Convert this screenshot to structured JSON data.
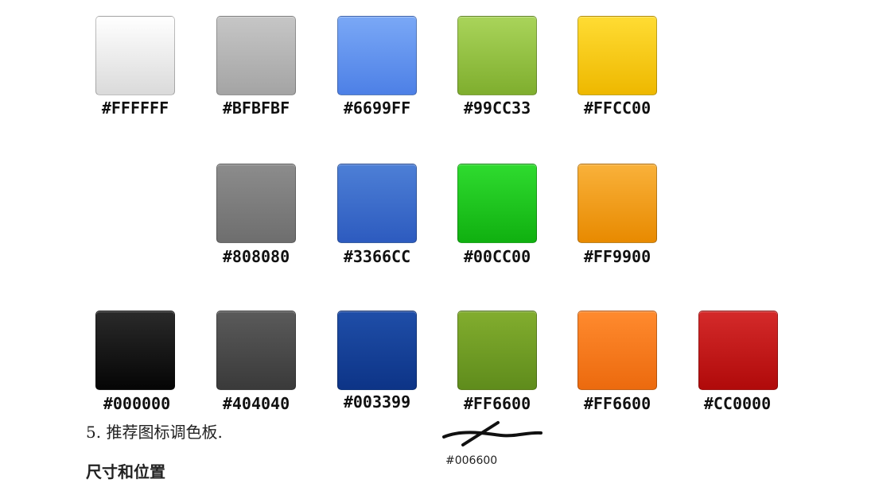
{
  "swatches": [
    {
      "label": "#FFFFFF",
      "color_top": "#ffffff",
      "color_bottom": "#dadada"
    },
    {
      "label": "#BFBFBF",
      "color_top": "#c6c6c6",
      "color_bottom": "#a4a4a4"
    },
    {
      "label": "#6699FF",
      "color_top": "#7aa8f6",
      "color_bottom": "#4d80e6"
    },
    {
      "label": "#99CC33",
      "color_top": "#a9d45a",
      "color_bottom": "#7fae2e"
    },
    {
      "label": "#FFCC00",
      "color_top": "#ffdc33",
      "color_bottom": "#eeb800"
    },
    {
      "label": "#808080",
      "color_top": "#8c8c8c",
      "color_bottom": "#6e6e6e"
    },
    {
      "label": "#3366CC",
      "color_top": "#4d7fd6",
      "color_bottom": "#2d5bbf"
    },
    {
      "label": "#00CC00",
      "color_top": "#2fdb2f",
      "color_bottom": "#10b010"
    },
    {
      "label": "#FF9900",
      "color_top": "#f9b13a",
      "color_bottom": "#e88a00"
    },
    {
      "label": "#000000",
      "color_top": "#2a2a2a",
      "color_bottom": "#050505"
    },
    {
      "label": "#404040",
      "color_top": "#5a5a5a",
      "color_bottom": "#3a3a3a"
    },
    {
      "label": "#003399",
      "color_top": "#1f4ea8",
      "color_bottom": "#0d3487"
    },
    {
      "label": "#FF6600",
      "color_top": "#82ad2e",
      "color_bottom": "#5f8c1c"
    },
    {
      "label": "#FF6600",
      "color_top": "#ff8a2e",
      "color_bottom": "#ec6a0e"
    },
    {
      "label": "#CC0000",
      "color_top": "#d42a2a",
      "color_bottom": "#b00a0a"
    }
  ],
  "caption": "5. 推荐图标调色板.",
  "cut_heading": "尺寸和位置",
  "handwritten_note": "#006600"
}
